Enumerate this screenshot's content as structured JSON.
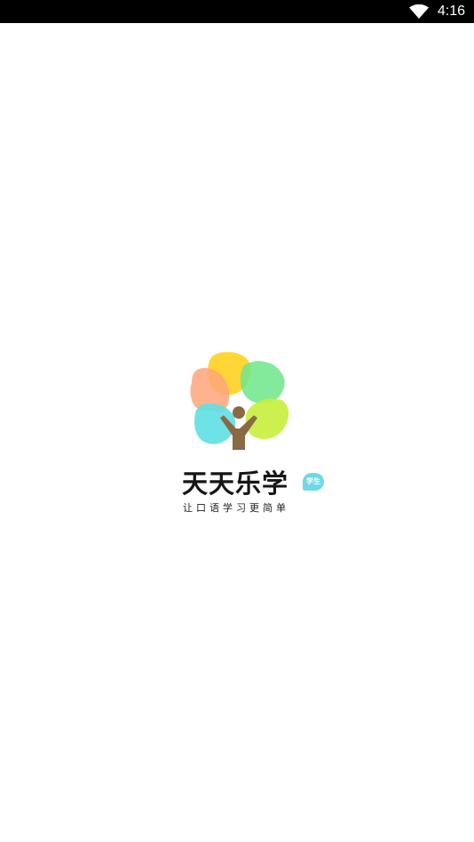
{
  "status_bar": {
    "time": "4:16",
    "wifi_icon": "wifi-icon"
  },
  "splash": {
    "app_name": "天天乐学",
    "badge": "学生",
    "slogan": "让口语学习更简单",
    "logo_icon": "tree-logo-icon"
  },
  "colors": {
    "leaf_yellow": "#ffd21f",
    "leaf_orange": "#ffa57a",
    "leaf_green": "#6ee68a",
    "leaf_cyan": "#5ee0e3",
    "leaf_lime": "#c6f03c",
    "trunk": "#8a6a43",
    "badge": "#6fd8e6"
  }
}
